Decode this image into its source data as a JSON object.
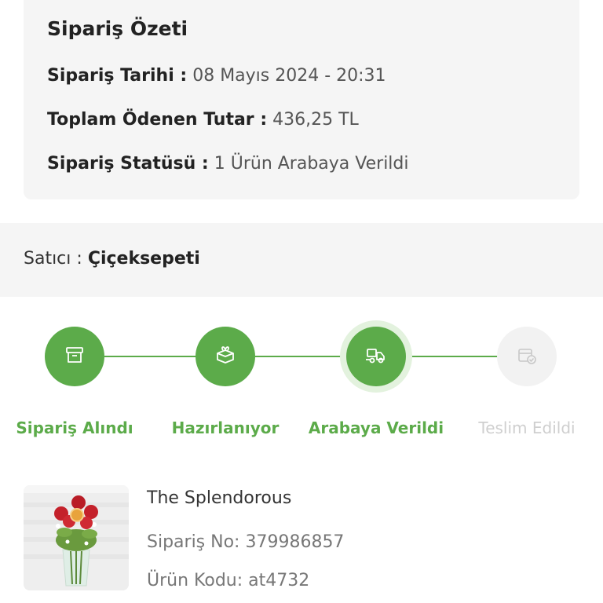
{
  "summary": {
    "title": "Sipariş Özeti",
    "date_label": "Sipariş Tarihi :",
    "date_value": "08 Mayıs 2024 - 20:31",
    "total_label": "Toplam Ödenen Tutar :",
    "total_value": "436,25 TL",
    "status_label": "Sipariş Statüsü :",
    "status_value": "1 Ürün Arabaya Verildi"
  },
  "seller": {
    "label": "Satıcı :",
    "name": "Çiçeksepeti"
  },
  "tracker": {
    "accent_color": "#5cab4a",
    "steps": [
      {
        "label": "Sipariş Alındı",
        "icon": "box-icon",
        "state": "done"
      },
      {
        "label": "Hazırlanıyor",
        "icon": "gift-icon",
        "state": "done"
      },
      {
        "label": "Arabaya Verildi",
        "icon": "delivery-truck-icon",
        "state": "current"
      },
      {
        "label": "Teslim Edildi",
        "icon": "package-check-icon",
        "state": "pending"
      }
    ]
  },
  "product": {
    "name": "The Splendorous",
    "order_no": "Sipariş No: 379986857",
    "code": "Ürün Kodu: at4732",
    "image_icon": "flower-bouquet-image"
  }
}
